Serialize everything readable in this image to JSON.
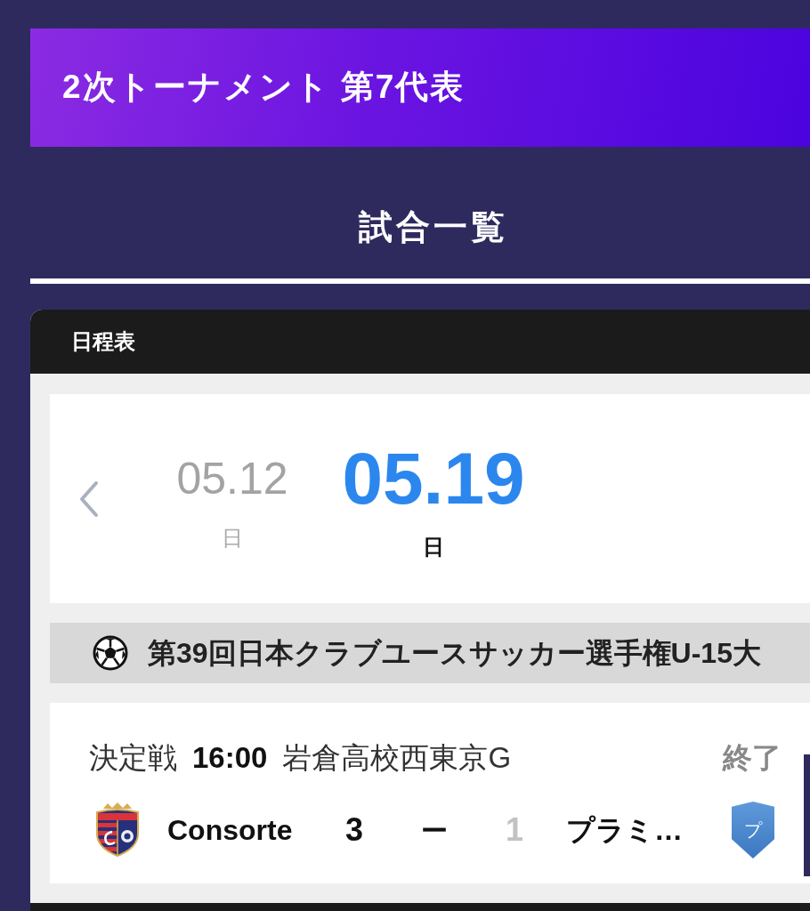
{
  "banner": {
    "title": "2次トーナメント 第7代表"
  },
  "section": {
    "title": "試合一覧"
  },
  "schedule": {
    "title": "日程表",
    "dates": [
      {
        "date": "05.12",
        "weekday": "日",
        "selected": false
      },
      {
        "date": "05.19",
        "weekday": "日",
        "selected": true
      }
    ],
    "competition": {
      "name": "第39回日本クラブユースサッカー選手権U-15大"
    },
    "matches": [
      {
        "round": "決定戦",
        "time": "16:00",
        "venue": "岩倉高校西東京G",
        "status": "終了",
        "separator": "ー",
        "home": {
          "kind": "crest",
          "name": "Consorte",
          "score": "3",
          "winner": true
        },
        "away": {
          "kind": "letter",
          "badge": "プ",
          "name": "プラミ…",
          "score": "1",
          "winner": false
        }
      }
    ]
  }
}
